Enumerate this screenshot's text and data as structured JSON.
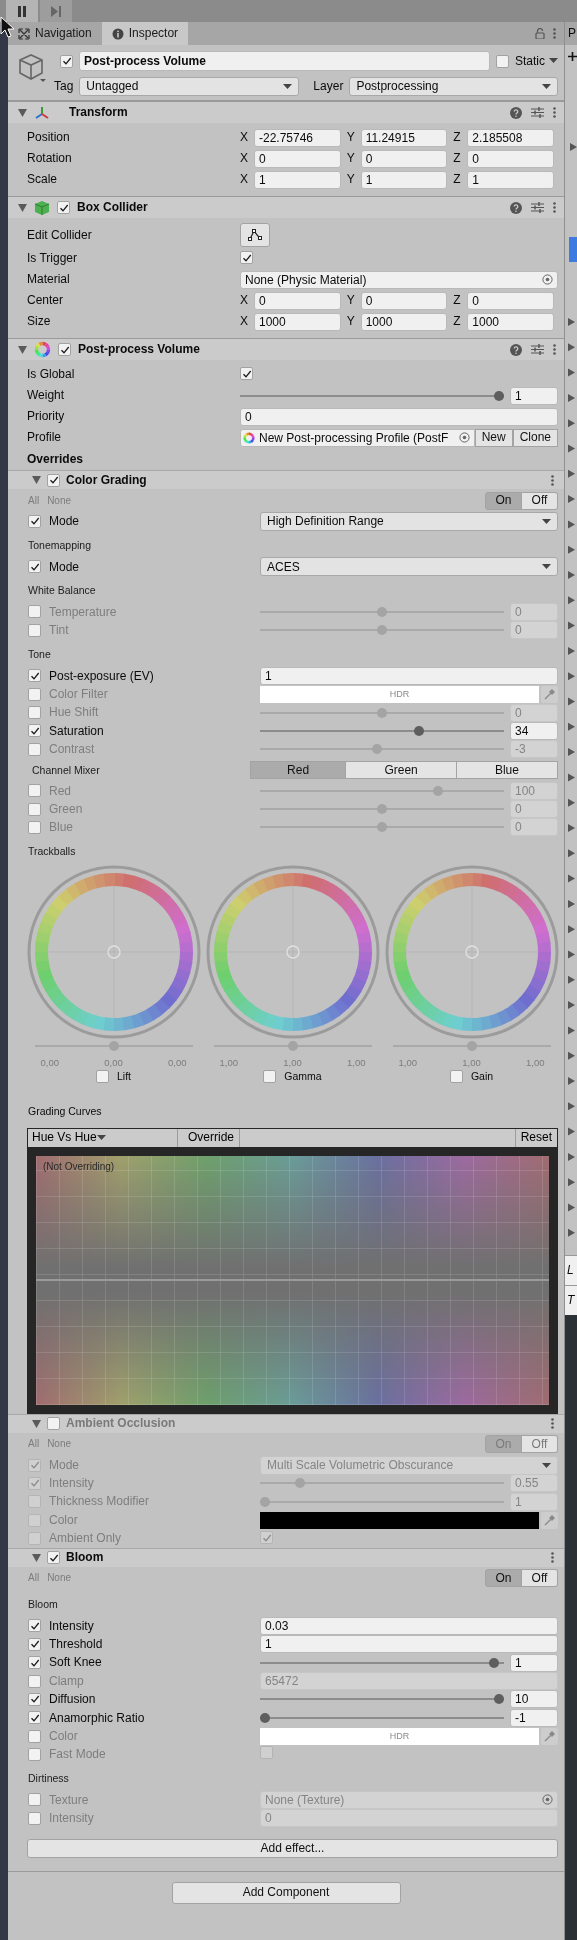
{
  "tabs": [
    {
      "label": "Navigation",
      "selected": false
    },
    {
      "label": "Inspector",
      "selected": true
    }
  ],
  "object": {
    "enabled": true,
    "name": "Post-process Volume",
    "static": false,
    "static_label": "Static",
    "tag_label": "Tag",
    "tag": "Untagged",
    "layer_label": "Layer",
    "layer": "Postprocessing"
  },
  "components": [
    {
      "kind": "transform",
      "title": "Transform",
      "rows": [
        {
          "kind": "vector",
          "label": "Position",
          "values": [
            {
              "axis": "X",
              "value": "-22.75746"
            },
            {
              "axis": "Y",
              "value": "11.24915"
            },
            {
              "axis": "Z",
              "value": "2.185508"
            }
          ]
        },
        {
          "kind": "vector",
          "label": "Rotation",
          "values": [
            {
              "axis": "X",
              "value": "0"
            },
            {
              "axis": "Y",
              "value": "0"
            },
            {
              "axis": "Z",
              "value": "0"
            }
          ]
        },
        {
          "kind": "vector",
          "label": "Scale",
          "values": [
            {
              "axis": "X",
              "value": "1"
            },
            {
              "axis": "Y",
              "value": "1"
            },
            {
              "axis": "Z",
              "value": "1"
            }
          ]
        }
      ]
    },
    {
      "kind": "collider",
      "title": "Box Collider",
      "enabled": true,
      "rows": [
        {
          "kind": "edit",
          "label": "Edit Collider"
        },
        {
          "kind": "checkbox",
          "label": "Is Trigger",
          "checked": true
        },
        {
          "kind": "object",
          "label": "Material",
          "value": "None (Physic Material)"
        },
        {
          "kind": "vector",
          "label": "Center",
          "values": [
            {
              "axis": "X",
              "value": "0"
            },
            {
              "axis": "Y",
              "value": "0"
            },
            {
              "axis": "Z",
              "value": "0"
            }
          ]
        },
        {
          "kind": "vector",
          "label": "Size",
          "values": [
            {
              "axis": "X",
              "value": "1000"
            },
            {
              "axis": "Y",
              "value": "1000"
            },
            {
              "axis": "Z",
              "value": "1000"
            }
          ]
        }
      ]
    },
    {
      "kind": "volume",
      "title": "Post-process Volume",
      "enabled": true,
      "rows": [
        {
          "kind": "checkbox",
          "label": "Is Global",
          "checked": true
        },
        {
          "kind": "slider",
          "label": "Weight",
          "level": 1,
          "value": "1"
        },
        {
          "kind": "field",
          "label": "Priority",
          "value": "0"
        },
        {
          "kind": "profile",
          "label": "Profile",
          "value": "New Post-processing Profile (PostF",
          "buttons": [
            "New",
            "Clone"
          ]
        },
        {
          "kind": "heading",
          "label": "Overrides"
        }
      ],
      "effects": [
        {
          "title": "Color Grading",
          "enabled": true,
          "all_label": "All",
          "none_label": "None",
          "toggle": [
            {
              "label": "On",
              "selected": true
            },
            {
              "label": "Off",
              "selected": false
            }
          ],
          "rows": [
            {
              "kind": "dropdown",
              "override": true,
              "label": "Mode",
              "value": "High Definition Range"
            },
            {
              "kind": "heading",
              "label": "Tonemapping"
            },
            {
              "kind": "dropdown",
              "override": true,
              "label": "Mode",
              "value": "ACES"
            },
            {
              "kind": "heading",
              "label": "White Balance"
            },
            {
              "kind": "slider",
              "override": false,
              "label": "Temperature",
              "level": 0.5,
              "value": "0"
            },
            {
              "kind": "slider",
              "override": false,
              "label": "Tint",
              "level": 0.5,
              "value": "0"
            },
            {
              "kind": "heading",
              "label": "Tone"
            },
            {
              "kind": "field",
              "override": true,
              "label": "Post-exposure (EV)",
              "value": "1"
            },
            {
              "kind": "color",
              "override": false,
              "label": "Color Filter",
              "color": "#ffffff",
              "value": "HDR"
            },
            {
              "kind": "slider",
              "override": false,
              "label": "Hue Shift",
              "level": 0.5,
              "value": "0"
            },
            {
              "kind": "slider",
              "override": true,
              "label": "Saturation",
              "level": 0.66,
              "value": "34"
            },
            {
              "kind": "slider",
              "override": false,
              "label": "Contrast",
              "level": 0.48,
              "value": "-3"
            },
            {
              "kind": "mixer",
              "label": "Channel Mixer",
              "tabs": [
                {
                  "label": "Red",
                  "selected": true
                },
                {
                  "label": "Green",
                  "selected": false
                },
                {
                  "label": "Blue",
                  "selected": false
                }
              ]
            },
            {
              "kind": "slider",
              "override": false,
              "label": "Red",
              "level": 0.74,
              "value": "100"
            },
            {
              "kind": "slider",
              "override": false,
              "label": "Green",
              "level": 0.5,
              "value": "0"
            },
            {
              "kind": "slider",
              "override": false,
              "label": "Blue",
              "level": 0.5,
              "value": "0"
            },
            {
              "kind": "heading",
              "label": "Trackballs"
            },
            {
              "kind": "trackballs",
              "items": [
                {
                  "label": "Lift",
                  "override": false,
                  "level": 0.5,
                  "values": [
                    "0,00",
                    "0,00",
                    "0,00"
                  ]
                },
                {
                  "label": "Gamma",
                  "override": false,
                  "level": 0.5,
                  "values": [
                    "1,00",
                    "1,00",
                    "1,00"
                  ]
                },
                {
                  "label": "Gain",
                  "override": false,
                  "level": 0.5,
                  "values": [
                    "1,00",
                    "1,00",
                    "1,00"
                  ]
                }
              ]
            },
            {
              "kind": "heading",
              "label": "Grading Curves"
            },
            {
              "kind": "curves",
              "curve": "Hue Vs Hue",
              "override_label": "Override",
              "reset_label": "Reset",
              "status": "(Not Overriding)"
            }
          ]
        },
        {
          "title": "Ambient Occlusion",
          "enabled": false,
          "all_label": "All",
          "none_label": "None",
          "toggle": [
            {
              "label": "On",
              "selected": true
            },
            {
              "label": "Off",
              "selected": false
            }
          ],
          "rows": [
            {
              "kind": "dropdown",
              "override": true,
              "label": "Mode",
              "value": "Multi Scale Volumetric Obscurance"
            },
            {
              "kind": "slider",
              "override": true,
              "label": "Intensity",
              "level": 0.15,
              "value": "0.55"
            },
            {
              "kind": "slider",
              "override": false,
              "label": "Thickness Modifier",
              "level": 0,
              "value": "1"
            },
            {
              "kind": "color",
              "override": false,
              "label": "Color",
              "color": "#000000"
            },
            {
              "kind": "checkbox",
              "override": false,
              "label": "Ambient Only",
              "checked": true
            }
          ]
        },
        {
          "title": "Bloom",
          "enabled": true,
          "all_label": "All",
          "none_label": "None",
          "toggle": [
            {
              "label": "On",
              "selected": true
            },
            {
              "label": "Off",
              "selected": false
            }
          ],
          "rows": [
            {
              "kind": "heading",
              "label": "Bloom"
            },
            {
              "kind": "field",
              "override": true,
              "label": "Intensity",
              "value": "0.03"
            },
            {
              "kind": "field",
              "override": true,
              "label": "Threshold",
              "value": "1"
            },
            {
              "kind": "slider",
              "override": true,
              "label": "Soft Knee",
              "level": 0.98,
              "value": "1"
            },
            {
              "kind": "field",
              "override": false,
              "label": "Clamp",
              "value": "65472"
            },
            {
              "kind": "slider",
              "override": true,
              "label": "Diffusion",
              "level": 1,
              "value": "10"
            },
            {
              "kind": "slider",
              "override": true,
              "label": "Anamorphic Ratio",
              "level": 0,
              "value": "-1"
            },
            {
              "kind": "color",
              "override": false,
              "label": "Color",
              "color": "#ffffff",
              "value": "HDR"
            },
            {
              "kind": "checkbox",
              "override": false,
              "label": "Fast Mode",
              "checked": false
            },
            {
              "kind": "heading",
              "label": "Dirtiness"
            },
            {
              "kind": "object",
              "override": false,
              "label": "Texture",
              "value": "None (Texture)"
            },
            {
              "kind": "field",
              "override": false,
              "label": "Intensity",
              "value": "0"
            }
          ]
        }
      ],
      "add_effect": "Add effect..."
    }
  ],
  "add_component": "Add Component",
  "side_panel": {
    "title": "P",
    "rows": [
      {
        "label": "L"
      },
      {
        "label": "T"
      }
    ]
  }
}
